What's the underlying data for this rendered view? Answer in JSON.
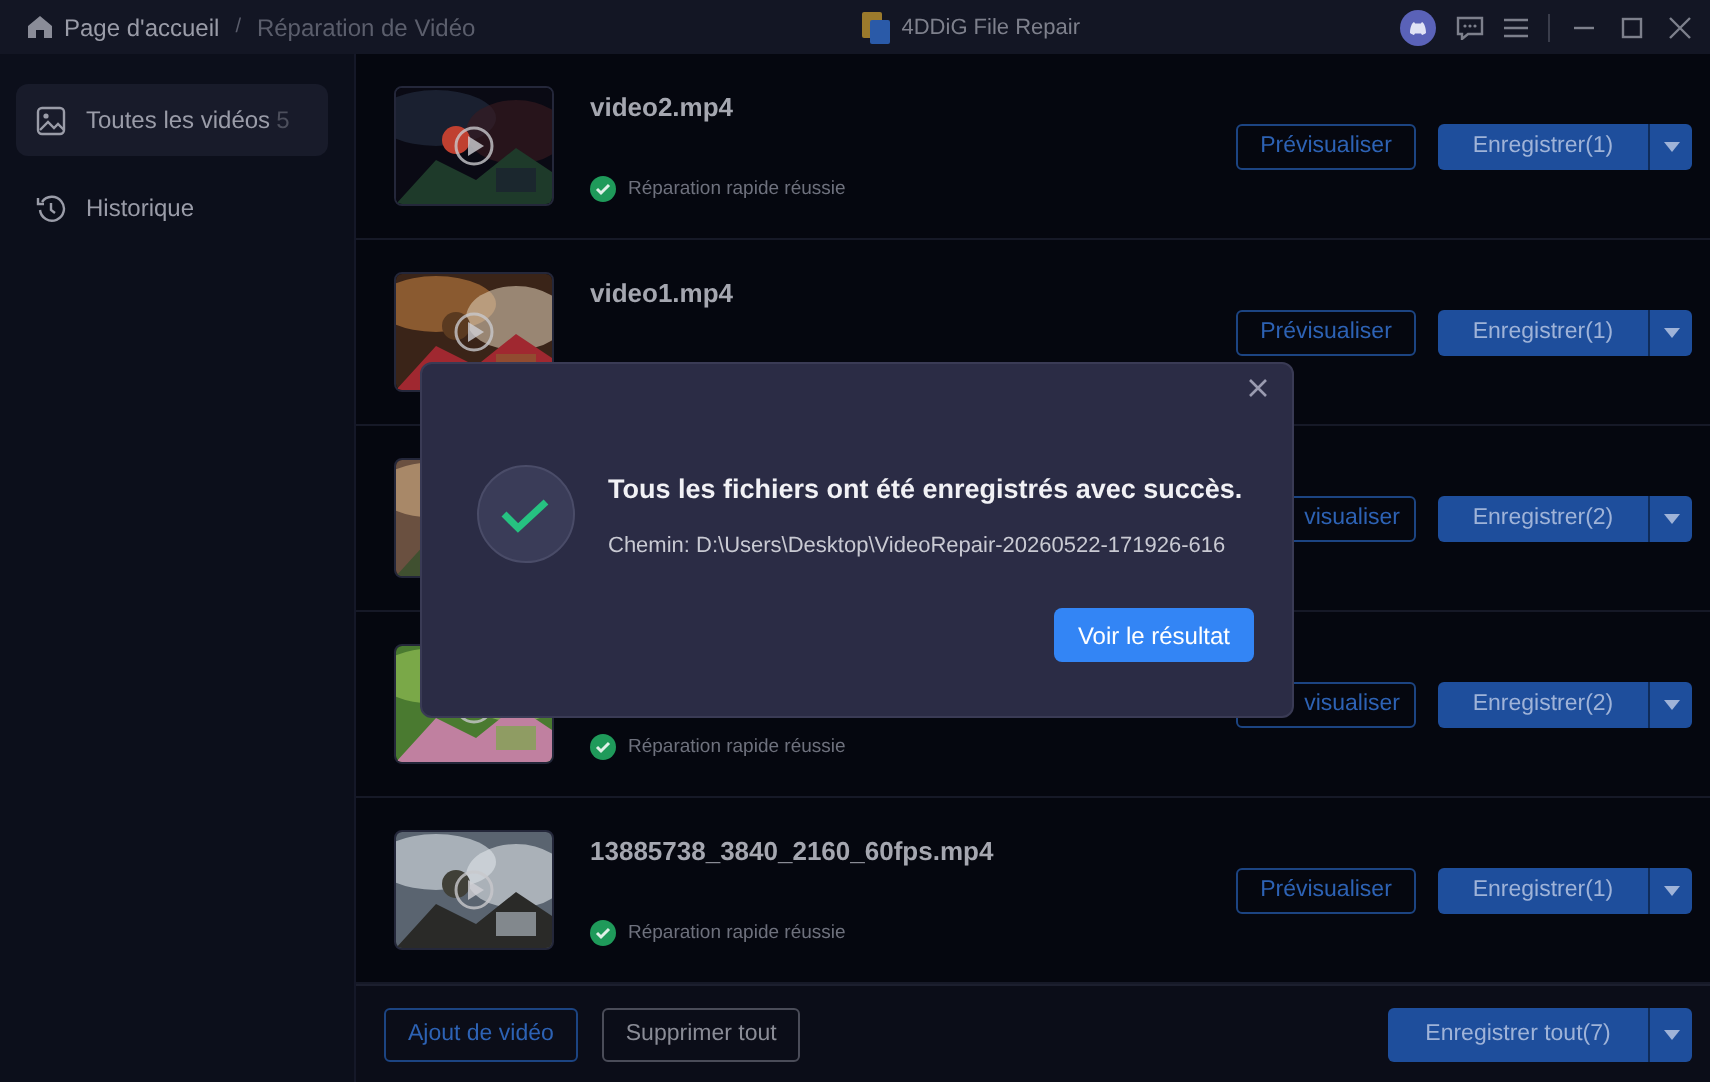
{
  "title_bar": {
    "breadcrumb": [
      "Page d'accueil",
      "/",
      "Réparation de Vidéo"
    ],
    "app_name": "4DDiG File Repair"
  },
  "sidebar": {
    "items": [
      {
        "label": "Toutes les vidéos",
        "count": "5",
        "selected": true,
        "kind": "videos"
      },
      {
        "label": "Historique",
        "selected": false,
        "kind": "history"
      }
    ]
  },
  "videos": [
    {
      "name": "video2.mp4",
      "status": "Réparation rapide réussie",
      "preview": "Prévisualiser",
      "save": "Enregistrer(1)"
    },
    {
      "name": "video1.mp4",
      "preview": "Prévisualiser",
      "save": "Enregistrer(1)"
    },
    {
      "preview": "visualiser",
      "save": "Enregistrer(2)"
    },
    {
      "status": "Réparation rapide réussie",
      "preview": "visualiser",
      "save": "Enregistrer(2)"
    },
    {
      "name": "13885738_3840_2160_60fps.mp4",
      "status": "Réparation rapide réussie",
      "preview": "Prévisualiser",
      "save": "Enregistrer(1)"
    }
  ],
  "footer": {
    "add": "Ajout de vidéo",
    "remove": "Supprimer tout",
    "save_all": "Enregistrer tout(7)"
  },
  "dialog": {
    "title": "Tous les fichiers ont été enregistrés avec succès.",
    "path_label": "Chemin:",
    "path": "D:\\Users\\Desktop\\VideoRepair-20260522-171926-616",
    "button": "Voir le résultat"
  }
}
